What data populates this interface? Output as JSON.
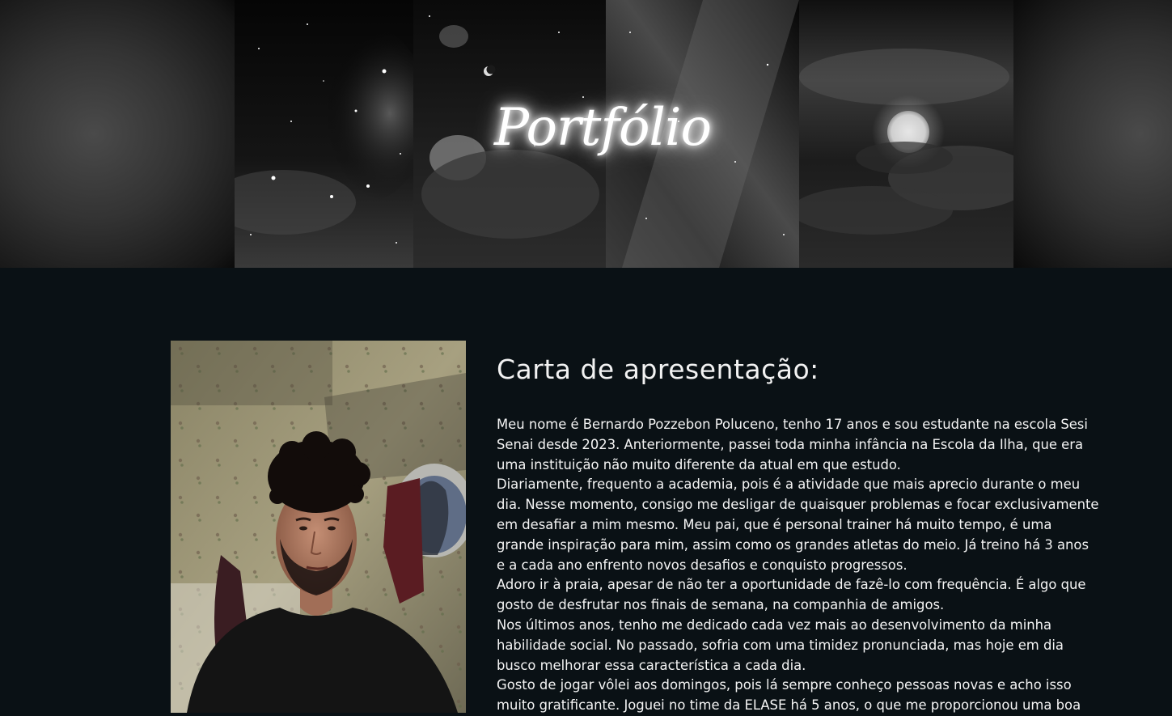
{
  "banner": {
    "title": "Portfólio"
  },
  "photo": {
    "alt": "Foto de Bernardo Pozzebon Poluceno"
  },
  "letter": {
    "title": "Carta de apresentação:",
    "paragraphs": [
      "Meu nome é Bernardo Pozzebon Poluceno, tenho 17 anos e sou estudante na escola Sesi Senai desde 2023. Anteriormente, passei toda minha infância na Escola da Ilha, que era uma instituição não muito diferente da atual em que estudo.",
      "Diariamente, frequento a academia, pois é a atividade que mais aprecio durante o meu dia. Nesse momento, consigo me desligar de quaisquer problemas e focar exclusivamente em desafiar a mim mesmo. Meu pai, que é personal trainer há muito tempo, é uma grande inspiração para mim, assim como os grandes atletas do meio. Já treino há 3 anos e a cada ano enfrento novos desafios e conquisto progressos.",
      "Adoro ir à praia, apesar de não ter a oportunidade de fazê-lo com frequência. É algo que gosto de desfrutar nos finais de semana, na companhia de amigos.",
      "Nos últimos anos, tenho me dedicado cada vez mais ao desenvolvimento da minha habilidade social. No passado, sofria com uma timidez pronunciada, mas hoje em dia busco melhorar essa característica a cada dia.",
      "Gosto de jogar vôlei aos domingos, pois lá sempre conheço pessoas novas e acho isso muito gratificante. Joguei no time da ELASE há 5 anos, o que me proporcionou uma boa"
    ]
  },
  "colors": {
    "page_background": "#0a1115",
    "text": "#ffffff"
  }
}
